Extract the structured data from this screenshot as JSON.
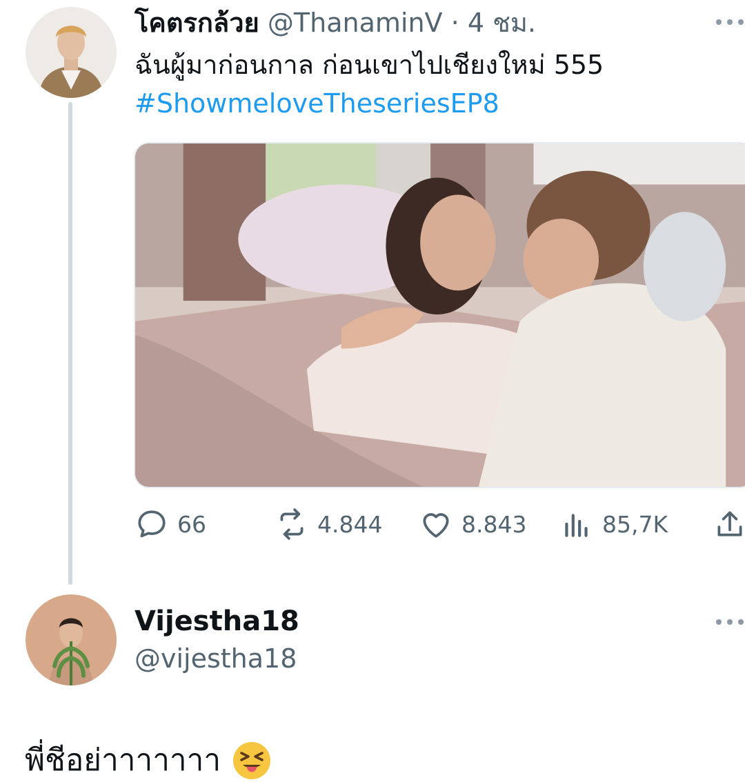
{
  "thread": {
    "original": {
      "display_name": "โคตรกล้วย",
      "handle": "@ThanaminV",
      "separator": "·",
      "time": "4 ชม.",
      "text": "ฉันผู้มาก่อนกาล ก่อนเขาไปเชียงใหม่ 555",
      "hashtag": "#ShowmeloveTheseriesEP8",
      "avatar_icon": "profile-avatar",
      "more_icon": "more-icon",
      "actions": {
        "replies": "66",
        "retweets": "4.844",
        "likes": "8.843",
        "views": "85,7K"
      }
    },
    "reply": {
      "display_name": "Vijestha18",
      "handle": "@vijestha18",
      "text": "พี่ชีอย่าาาาาาา",
      "emoji": "squinting-face-with-tongue"
    }
  },
  "colors": {
    "text_primary": "#0f1419",
    "text_secondary": "#536471",
    "link": "#1d9bf0",
    "thread_line": "#cfd9de"
  }
}
